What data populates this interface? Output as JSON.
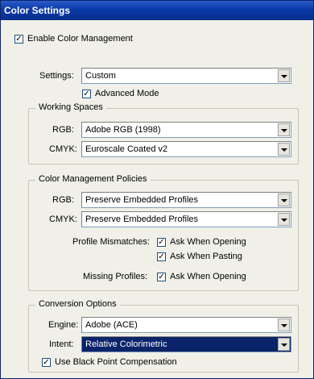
{
  "window": {
    "title": "Color Settings"
  },
  "enable_cm": {
    "label": "Enable Color Management",
    "checked": true
  },
  "settings": {
    "label": "Settings:",
    "value": "Custom"
  },
  "advanced_mode": {
    "label": "Advanced Mode",
    "checked": true
  },
  "working_spaces": {
    "title": "Working Spaces",
    "rgb": {
      "label": "RGB:",
      "value": "Adobe RGB (1998)"
    },
    "cmyk": {
      "label": "CMYK:",
      "value": "Euroscale Coated v2"
    }
  },
  "policies": {
    "title": "Color Management Policies",
    "rgb": {
      "label": "RGB:",
      "value": "Preserve Embedded Profiles"
    },
    "cmyk": {
      "label": "CMYK:",
      "value": "Preserve Embedded Profiles"
    },
    "profile_mismatches": {
      "label": "Profile Mismatches:",
      "ask_opening": {
        "label": "Ask When Opening",
        "checked": true
      },
      "ask_pasting": {
        "label": "Ask When Pasting",
        "checked": true
      }
    },
    "missing_profiles": {
      "label": "Missing Profiles:",
      "ask_opening": {
        "label": "Ask When Opening",
        "checked": true
      }
    }
  },
  "conversion": {
    "title": "Conversion Options",
    "engine": {
      "label": "Engine:",
      "value": "Adobe (ACE)"
    },
    "intent": {
      "label": "Intent:",
      "value": "Relative Colorimetric"
    },
    "black_point": {
      "label": "Use Black Point Compensation",
      "checked": true
    }
  },
  "check_mark": "✓",
  "colors": {
    "title_bar": "#0a3aa8",
    "selection": "#0a246a",
    "window_bg": "#f0f0e8"
  }
}
